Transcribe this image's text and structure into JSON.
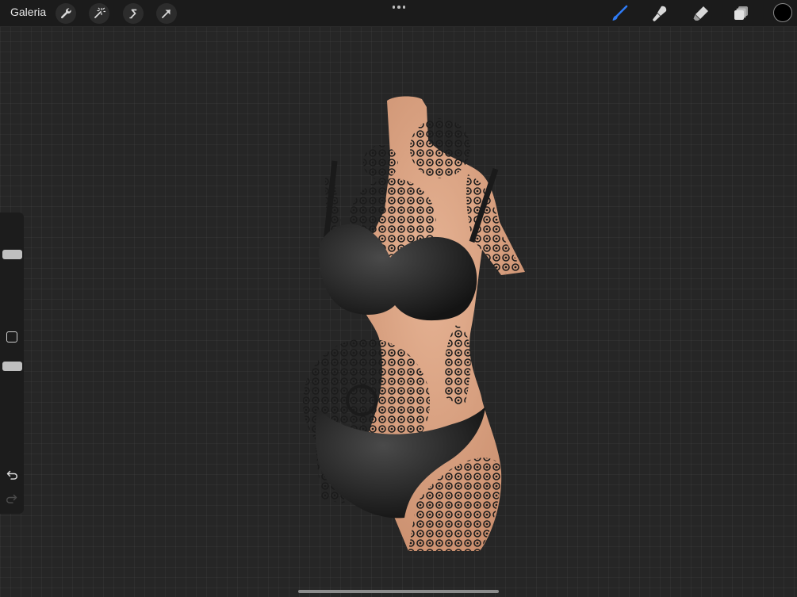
{
  "topbar": {
    "gallery_label": "Galeria",
    "left_tools": [
      {
        "name": "actions",
        "icon": "wrench-icon"
      },
      {
        "name": "adjustments",
        "icon": "magic-wand-icon"
      },
      {
        "name": "selection",
        "icon": "selection-s-icon"
      },
      {
        "name": "transform",
        "icon": "arrow-icon"
      }
    ],
    "right_tools": [
      {
        "name": "brush",
        "icon": "brush-icon",
        "active": true
      },
      {
        "name": "smudge",
        "icon": "smudge-icon"
      },
      {
        "name": "eraser",
        "icon": "eraser-icon"
      },
      {
        "name": "layers",
        "icon": "layers-icon"
      }
    ],
    "current_color": "#000000",
    "active_tool_color": "#2f7bf5"
  },
  "sidebar": {
    "size_slider_value": 0.65,
    "opacity_slider_value": 0.9
  },
  "canvas": {
    "subject": "tattooed-torso-3d-model"
  }
}
